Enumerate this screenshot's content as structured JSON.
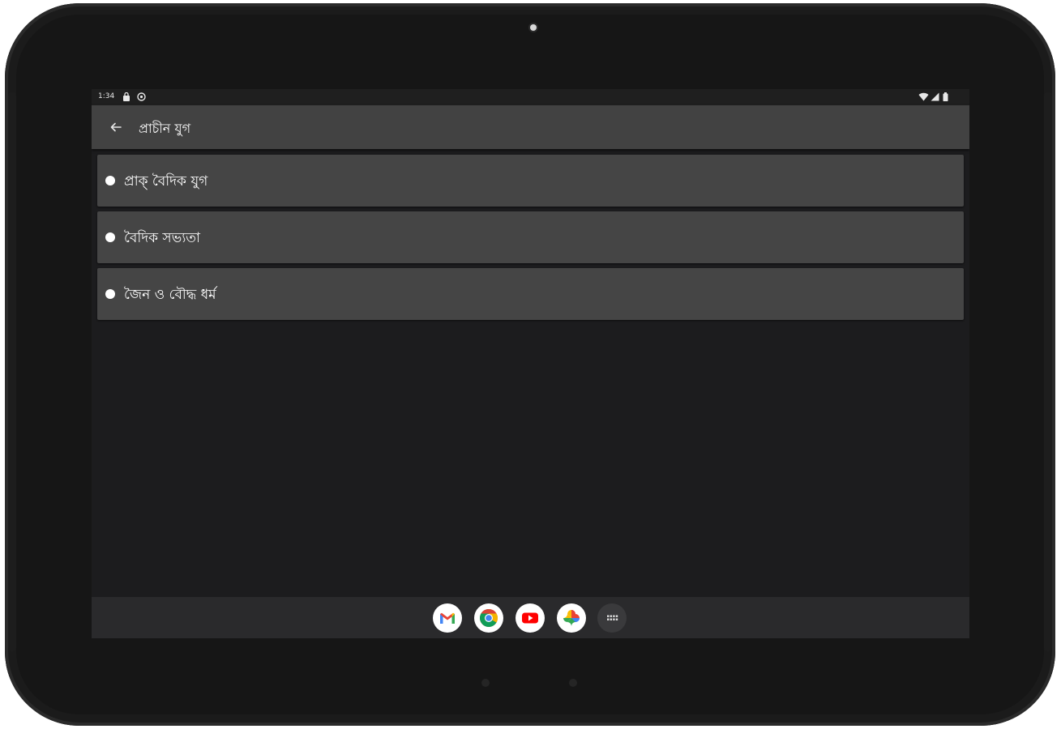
{
  "status_bar": {
    "time": "1:34"
  },
  "app_bar": {
    "title": "প্রাচীন যুগ",
    "back_icon": "arrow-back-icon"
  },
  "list": {
    "items": [
      {
        "label": "প্রাক্ বৈদিক যুগ"
      },
      {
        "label": "বৈদিক সভ্যতা"
      },
      {
        "label": "জৈন ও বৌদ্ধ ধর্ম"
      }
    ]
  },
  "taskbar": {
    "apps": [
      "gmail-icon",
      "chrome-icon",
      "youtube-icon",
      "photos-icon",
      "app-drawer-icon"
    ]
  },
  "colors": {
    "app_bar": "#424242",
    "list_item": "#454545",
    "background": "#1c1c1e",
    "taskbar": "#2a2a2c"
  }
}
